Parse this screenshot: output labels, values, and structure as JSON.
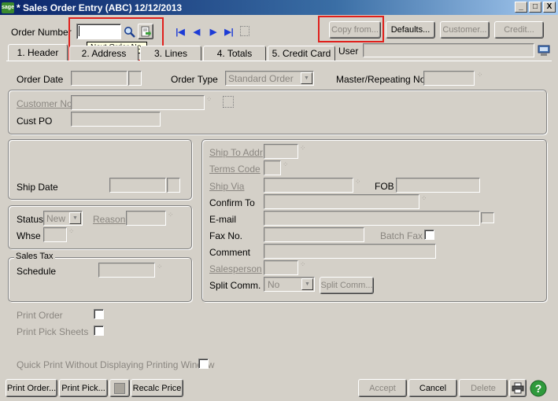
{
  "window": {
    "logo": "sage",
    "title": "* Sales Order Entry (ABC) 12/12/2013",
    "controls": [
      "_",
      "□",
      "X"
    ]
  },
  "toolbar": {
    "order_number_label": "Order Number",
    "order_number_value": "",
    "tooltip": "Next Order No.",
    "copy_from": "Copy from...",
    "defaults": "Defaults...",
    "customer": "Customer...",
    "credit": "Credit..."
  },
  "tabs": [
    {
      "label": "1. Header"
    },
    {
      "label": "2. Address"
    },
    {
      "label": "3. Lines"
    },
    {
      "label": "4. Totals"
    },
    {
      "label": "5. Credit Card"
    }
  ],
  "user_label": "User",
  "header": {
    "order_date_label": "Order Date",
    "order_type_label": "Order Type",
    "order_type_value": "Standard Order",
    "master_repeating_label": "Master/Repeating No.",
    "customer_no_label": "Customer No.",
    "cust_po_label": "Cust PO",
    "ship_date_label": "Ship Date",
    "status_label": "Status",
    "status_value": "New",
    "reason_label": "Reason",
    "whse_label": "Whse",
    "sales_tax_caption": "Sales Tax",
    "schedule_label": "Schedule"
  },
  "shipping": {
    "ship_to_addr_label": "Ship To Addr",
    "terms_code_label": "Terms Code",
    "ship_via_label": "Ship Via",
    "fob_label": "FOB",
    "confirm_to_label": "Confirm To",
    "email_label": "E-mail",
    "fax_no_label": "Fax No.",
    "batch_fax_label": "Batch Fax",
    "comment_label": "Comment",
    "salesperson_label": "Salesperson",
    "split_comm_label": "Split Comm.",
    "split_comm_value": "No",
    "split_comm_button": "Split Comm..."
  },
  "print_options": {
    "print_order_label": "Print Order",
    "print_pick_sheets_label": "Print Pick Sheets",
    "quick_print_label": "Quick Print Without Displaying Printing Window"
  },
  "footer": {
    "print_order": "Print Order...",
    "print_pick": "Print Pick...",
    "recalc_price": "Recalc Price",
    "accept": "Accept",
    "cancel": "Cancel",
    "delete": "Delete"
  }
}
